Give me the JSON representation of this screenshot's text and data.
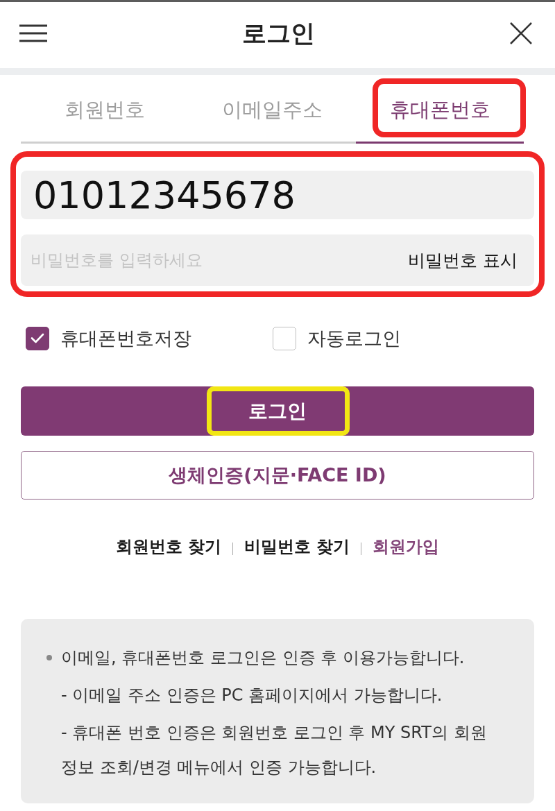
{
  "header": {
    "title": "로그인"
  },
  "tabs": [
    {
      "label": "회원번호",
      "selected": false,
      "highlighted": false
    },
    {
      "label": "이메일주소",
      "selected": false,
      "highlighted": false
    },
    {
      "label": "휴대폰번호",
      "selected": true,
      "highlighted": true
    }
  ],
  "credentials": {
    "highlighted": true,
    "phone": {
      "value": "01012345678"
    },
    "password": {
      "placeholder": "비밀번호를 입력하세요",
      "toggle_label": "비밀번호 표시"
    }
  },
  "options": [
    {
      "label": "휴대폰번호저장",
      "checked": true
    },
    {
      "label": "자동로그인",
      "checked": false
    }
  ],
  "login_button": {
    "label": "로그인",
    "highlighted": true
  },
  "biometric_button": {
    "label": "생체인증(지문·FACE ID)"
  },
  "links": [
    {
      "label": "회원번호 찾기",
      "kind": "plain"
    },
    {
      "label": "비밀번호 찾기",
      "kind": "plain"
    },
    {
      "label": "회원가입",
      "kind": "accent"
    }
  ],
  "notice": {
    "bullet": "이메일, 휴대폰번호 로그인은 인증 후 이용가능합니다.",
    "notes": [
      "- 이메일 주소 인증은 PC 홈페이지에서 가능합니다.",
      "- 휴대폰 번호 인증은 회원번호 로그인 후 MY SRT의 회원 정보 조회/변경 메뉴에서 인증 가능합니다."
    ]
  }
}
